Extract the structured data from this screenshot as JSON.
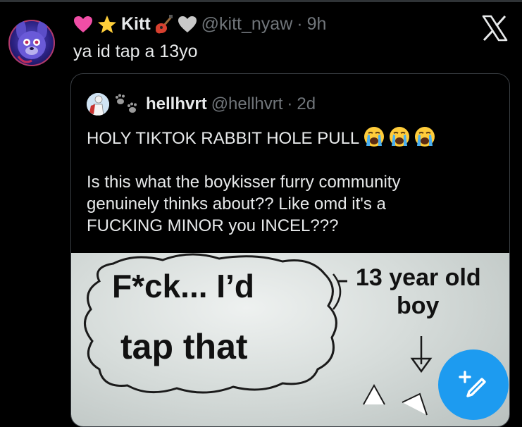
{
  "tweet": {
    "display_name": "Kitt",
    "handle": "@kitt_nyaw",
    "separator": "·",
    "time": "9h",
    "text": "ya id tap a 13yo",
    "name_emojis": [
      "pink-heart",
      "glowing-star",
      "guitar",
      "white-heart"
    ]
  },
  "quote": {
    "display_name": "hellhvrt",
    "handle": "@hellhvrt",
    "separator": "·",
    "time": "2d",
    "lines": [
      "HOLY TIKTOK RABBIT HOLE PULL",
      "Is this what the boykisser furry community",
      "genuinely thinks about?? Like omd it's a",
      "FUCKING MINOR you INCEL???"
    ],
    "line1_emojis": [
      "loudly-crying-face",
      "loudly-crying-face",
      "loudly-crying-face"
    ],
    "image": {
      "bubble_line1": "F*ck... I’d",
      "bubble_line2": "tap that",
      "label_line1": "13 year old",
      "label_line2": "boy"
    }
  },
  "icons": {
    "close": "x-logo-icon",
    "compose": "compose-post-icon"
  },
  "colors": {
    "accent": "#1d9bf0",
    "muted": "#71767b",
    "text": "#e7e9ea",
    "border": "#3a3f44"
  }
}
